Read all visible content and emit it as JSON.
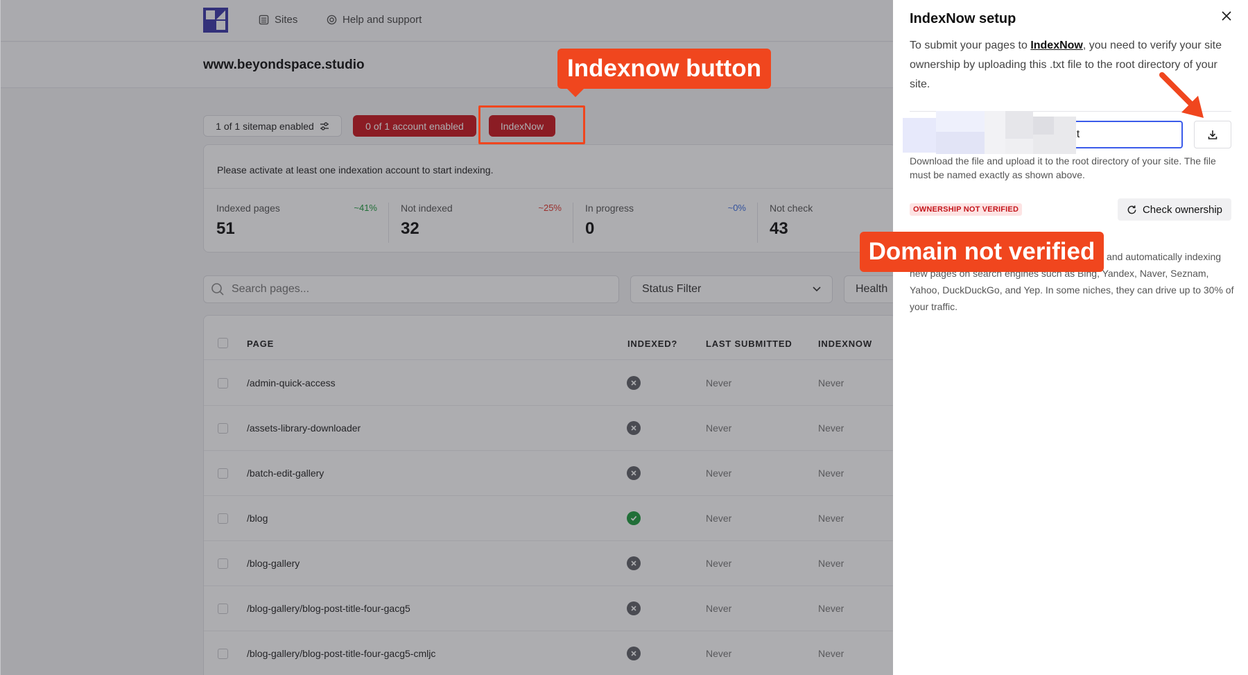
{
  "nav": {
    "sites": "Sites",
    "help": "Help and support"
  },
  "site": {
    "name": "www.beyondspace.studio"
  },
  "filters": {
    "sitemap": "1 of 1 sitemap enabled",
    "accounts": "0 of 1 account enabled",
    "indexnow": "IndexNow"
  },
  "notice": "Please activate at least one indexation account to start indexing.",
  "stats": [
    {
      "label": "Indexed pages",
      "value": "51",
      "delta": "~41%",
      "delta_color": "#1e9b3e"
    },
    {
      "label": "Not indexed",
      "value": "32",
      "delta": "~25%",
      "delta_color": "#e0352b"
    },
    {
      "label": "In progress",
      "value": "0",
      "delta": "~0%",
      "delta_color": "#3b6de0"
    },
    {
      "label": "Not check",
      "value": "43",
      "delta": "",
      "delta_color": "#777777"
    }
  ],
  "search": {
    "placeholder": "Search pages..."
  },
  "status_filter": "Status Filter",
  "health_filter": "Health",
  "table": {
    "headers": {
      "page": "PAGE",
      "indexed": "INDEXED?",
      "last_submitted": "LAST SUBMITTED",
      "indexnow": "INDEXNOW"
    },
    "rows": [
      {
        "page": "/admin-quick-access",
        "indexed": false,
        "last": "Never",
        "indexnow": "Never"
      },
      {
        "page": "/assets-library-downloader",
        "indexed": false,
        "last": "Never",
        "indexnow": "Never"
      },
      {
        "page": "/batch-edit-gallery",
        "indexed": false,
        "last": "Never",
        "indexnow": "Never"
      },
      {
        "page": "/blog",
        "indexed": true,
        "last": "Never",
        "indexnow": "Never"
      },
      {
        "page": "/blog-gallery",
        "indexed": false,
        "last": "Never",
        "indexnow": "Never"
      },
      {
        "page": "/blog-gallery/blog-post-title-four-gacg5",
        "indexed": false,
        "last": "Never",
        "indexnow": "Never"
      },
      {
        "page": "/blog-gallery/blog-post-title-four-gacg5-cmljc",
        "indexed": false,
        "last": "Never",
        "indexnow": "Never"
      }
    ]
  },
  "annotations": {
    "button": "Indexnow button",
    "domain": "Domain not verified",
    "accent": "#f0461e"
  },
  "panel": {
    "title": "IndexNow setup",
    "desc_before": "To submit your pages to ",
    "desc_link": "IndexNow",
    "desc_after": ", you need to verify your site ownership by uploading this .txt file to the root directory of your site.",
    "file_value": "59.txt",
    "help": "Download the file and upload it to the root directory of your site. The file must be named exactly as shown above.",
    "badge": "OWNERSHIP NOT VERIFIED",
    "check_button": "Check ownership",
    "footer": "IndexNow lets you submit your current pages and automatically indexing new pages on search engines such as Bing, Yandex, Naver, Seznam, Yahoo, DuckDuckGo, and Yep. In some niches, they can drive up to 30% of your traffic."
  },
  "colors": {
    "primary_red": "#c8161d",
    "focus_blue": "#3b5bea",
    "logo": "#3a37a8"
  }
}
